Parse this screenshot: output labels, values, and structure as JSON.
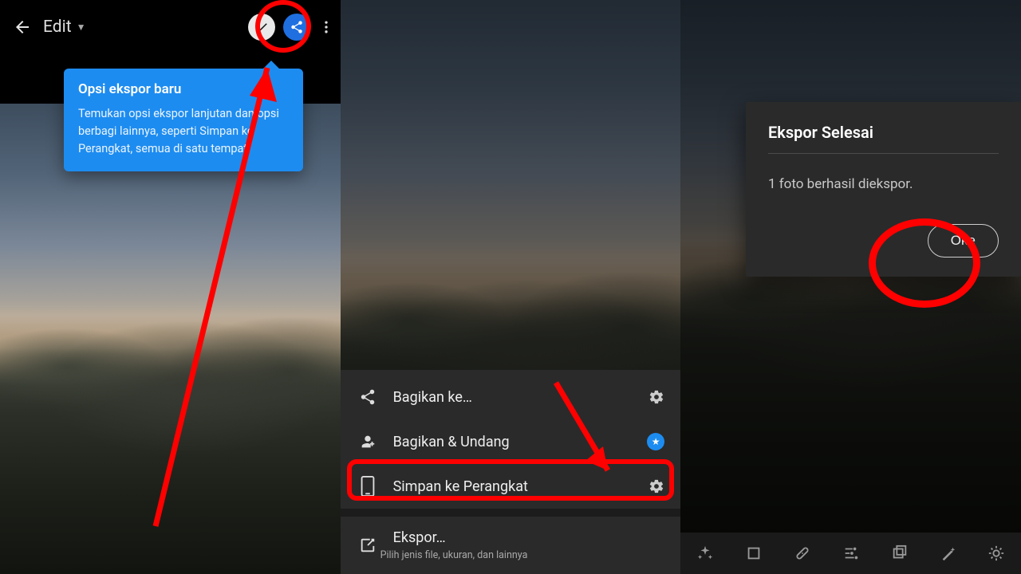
{
  "pane1": {
    "title": "Edit",
    "tooltip": {
      "title": "Opsi ekspor baru",
      "body": "Temukan opsi ekspor lanjutan dan opsi berbagi lainnya, seperti Simpan ke Perangkat, semua di satu tempat."
    }
  },
  "pane2": {
    "share": "Bagikan ke…",
    "invite": "Bagikan & Undang",
    "save": "Simpan ke Perangkat",
    "export": "Ekspor…",
    "export_sub": "Pilih jenis file, ukuran, dan lainnya"
  },
  "pane3": {
    "dialog_title": "Ekspor Selesai",
    "dialog_body": "1 foto berhasil diekspor.",
    "ok": "Oke"
  }
}
